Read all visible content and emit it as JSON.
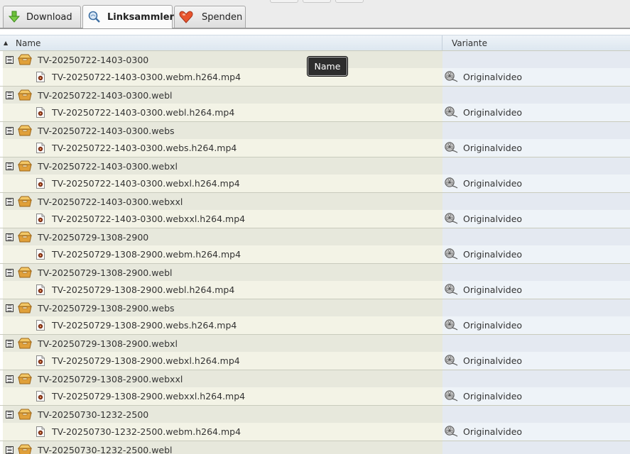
{
  "tabs": [
    {
      "label": "Download",
      "icon": "download-arrow-icon",
      "active": false
    },
    {
      "label": "Linksammler",
      "icon": "linkgrabber-icon",
      "active": true
    },
    {
      "label": "Spenden",
      "icon": "heart-icon",
      "active": false
    }
  ],
  "table": {
    "columns": [
      {
        "label": "Name",
        "sort_indicator": "▲"
      },
      {
        "label": "Variante"
      }
    ],
    "tooltip": "Name",
    "rows": [
      {
        "type": "package",
        "name": "TV-20250722-1403-0300"
      },
      {
        "type": "file",
        "name": "TV-20250722-1403-0300.webm.h264.mp4",
        "variant": "Originalvideo"
      },
      {
        "type": "package",
        "name": "TV-20250722-1403-0300.webl"
      },
      {
        "type": "file",
        "name": "TV-20250722-1403-0300.webl.h264.mp4",
        "variant": "Originalvideo"
      },
      {
        "type": "package",
        "name": "TV-20250722-1403-0300.webs"
      },
      {
        "type": "file",
        "name": "TV-20250722-1403-0300.webs.h264.mp4",
        "variant": "Originalvideo"
      },
      {
        "type": "package",
        "name": "TV-20250722-1403-0300.webxl"
      },
      {
        "type": "file",
        "name": "TV-20250722-1403-0300.webxl.h264.mp4",
        "variant": "Originalvideo"
      },
      {
        "type": "package",
        "name": "TV-20250722-1403-0300.webxxl"
      },
      {
        "type": "file",
        "name": "TV-20250722-1403-0300.webxxl.h264.mp4",
        "variant": "Originalvideo"
      },
      {
        "type": "package",
        "name": "TV-20250729-1308-2900"
      },
      {
        "type": "file",
        "name": "TV-20250729-1308-2900.webm.h264.mp4",
        "variant": "Originalvideo"
      },
      {
        "type": "package",
        "name": "TV-20250729-1308-2900.webl"
      },
      {
        "type": "file",
        "name": "TV-20250729-1308-2900.webl.h264.mp4",
        "variant": "Originalvideo"
      },
      {
        "type": "package",
        "name": "TV-20250729-1308-2900.webs"
      },
      {
        "type": "file",
        "name": "TV-20250729-1308-2900.webs.h264.mp4",
        "variant": "Originalvideo"
      },
      {
        "type": "package",
        "name": "TV-20250729-1308-2900.webxl"
      },
      {
        "type": "file",
        "name": "TV-20250729-1308-2900.webxl.h264.mp4",
        "variant": "Originalvideo"
      },
      {
        "type": "package",
        "name": "TV-20250729-1308-2900.webxxl"
      },
      {
        "type": "file",
        "name": "TV-20250729-1308-2900.webxxl.h264.mp4",
        "variant": "Originalvideo"
      },
      {
        "type": "package",
        "name": "TV-20250730-1232-2500"
      },
      {
        "type": "file",
        "name": "TV-20250730-1232-2500.webm.h264.mp4",
        "variant": "Originalvideo"
      },
      {
        "type": "package",
        "name": "TV-20250730-1232-2500.webl"
      }
    ]
  }
}
